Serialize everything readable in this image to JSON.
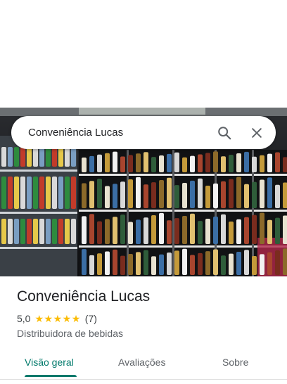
{
  "search": {
    "query": "Conveniência Lucas"
  },
  "place": {
    "name": "Conveniência Lucas",
    "rating": "5,0",
    "stars": 5,
    "review_count": "(7)",
    "category": "Distribuidora de bebidas"
  },
  "tabs": [
    {
      "label": "Visão geral",
      "active": true
    },
    {
      "label": "Avaliações",
      "active": false
    },
    {
      "label": "Sobre",
      "active": false
    }
  ],
  "colors": {
    "accent": "#00796b",
    "star": "#fbbc04"
  },
  "icons": {
    "search": "search-icon",
    "close": "close-icon",
    "star": "star-icon"
  }
}
